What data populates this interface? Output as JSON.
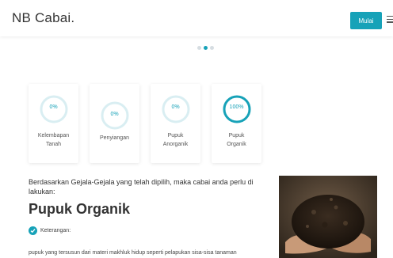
{
  "navbar": {
    "brand": "NB Cabai.",
    "start_button": "Mulai"
  },
  "carousel": {
    "count": 3,
    "active_index": 1
  },
  "cards": [
    {
      "percent_text": "0%",
      "value": 0,
      "label_lines": [
        "Kelembapan",
        "Tanah"
      ]
    },
    {
      "percent_text": "0%",
      "value": 0,
      "label_lines": [
        "Penyiangan"
      ]
    },
    {
      "percent_text": "0%",
      "value": 0,
      "label_lines": [
        "Pupuk",
        "Anorganik"
      ]
    },
    {
      "percent_text": "100%",
      "value": 100,
      "label_lines": [
        "Pupuk",
        "Organik"
      ]
    }
  ],
  "result": {
    "lead": "Berdasarkan Gejala-Gejala yang telah dipilih, maka cabai anda perlu di lakukan:",
    "title": "Pupuk Organik",
    "note_label": "Keterangan:",
    "description": "pupuk yang tersusun dari materi makhluk hidup seperti pelapukan sisa-sisa tanaman"
  },
  "colors": {
    "accent": "#17a2b8",
    "ring_track": "#d9eef2"
  }
}
